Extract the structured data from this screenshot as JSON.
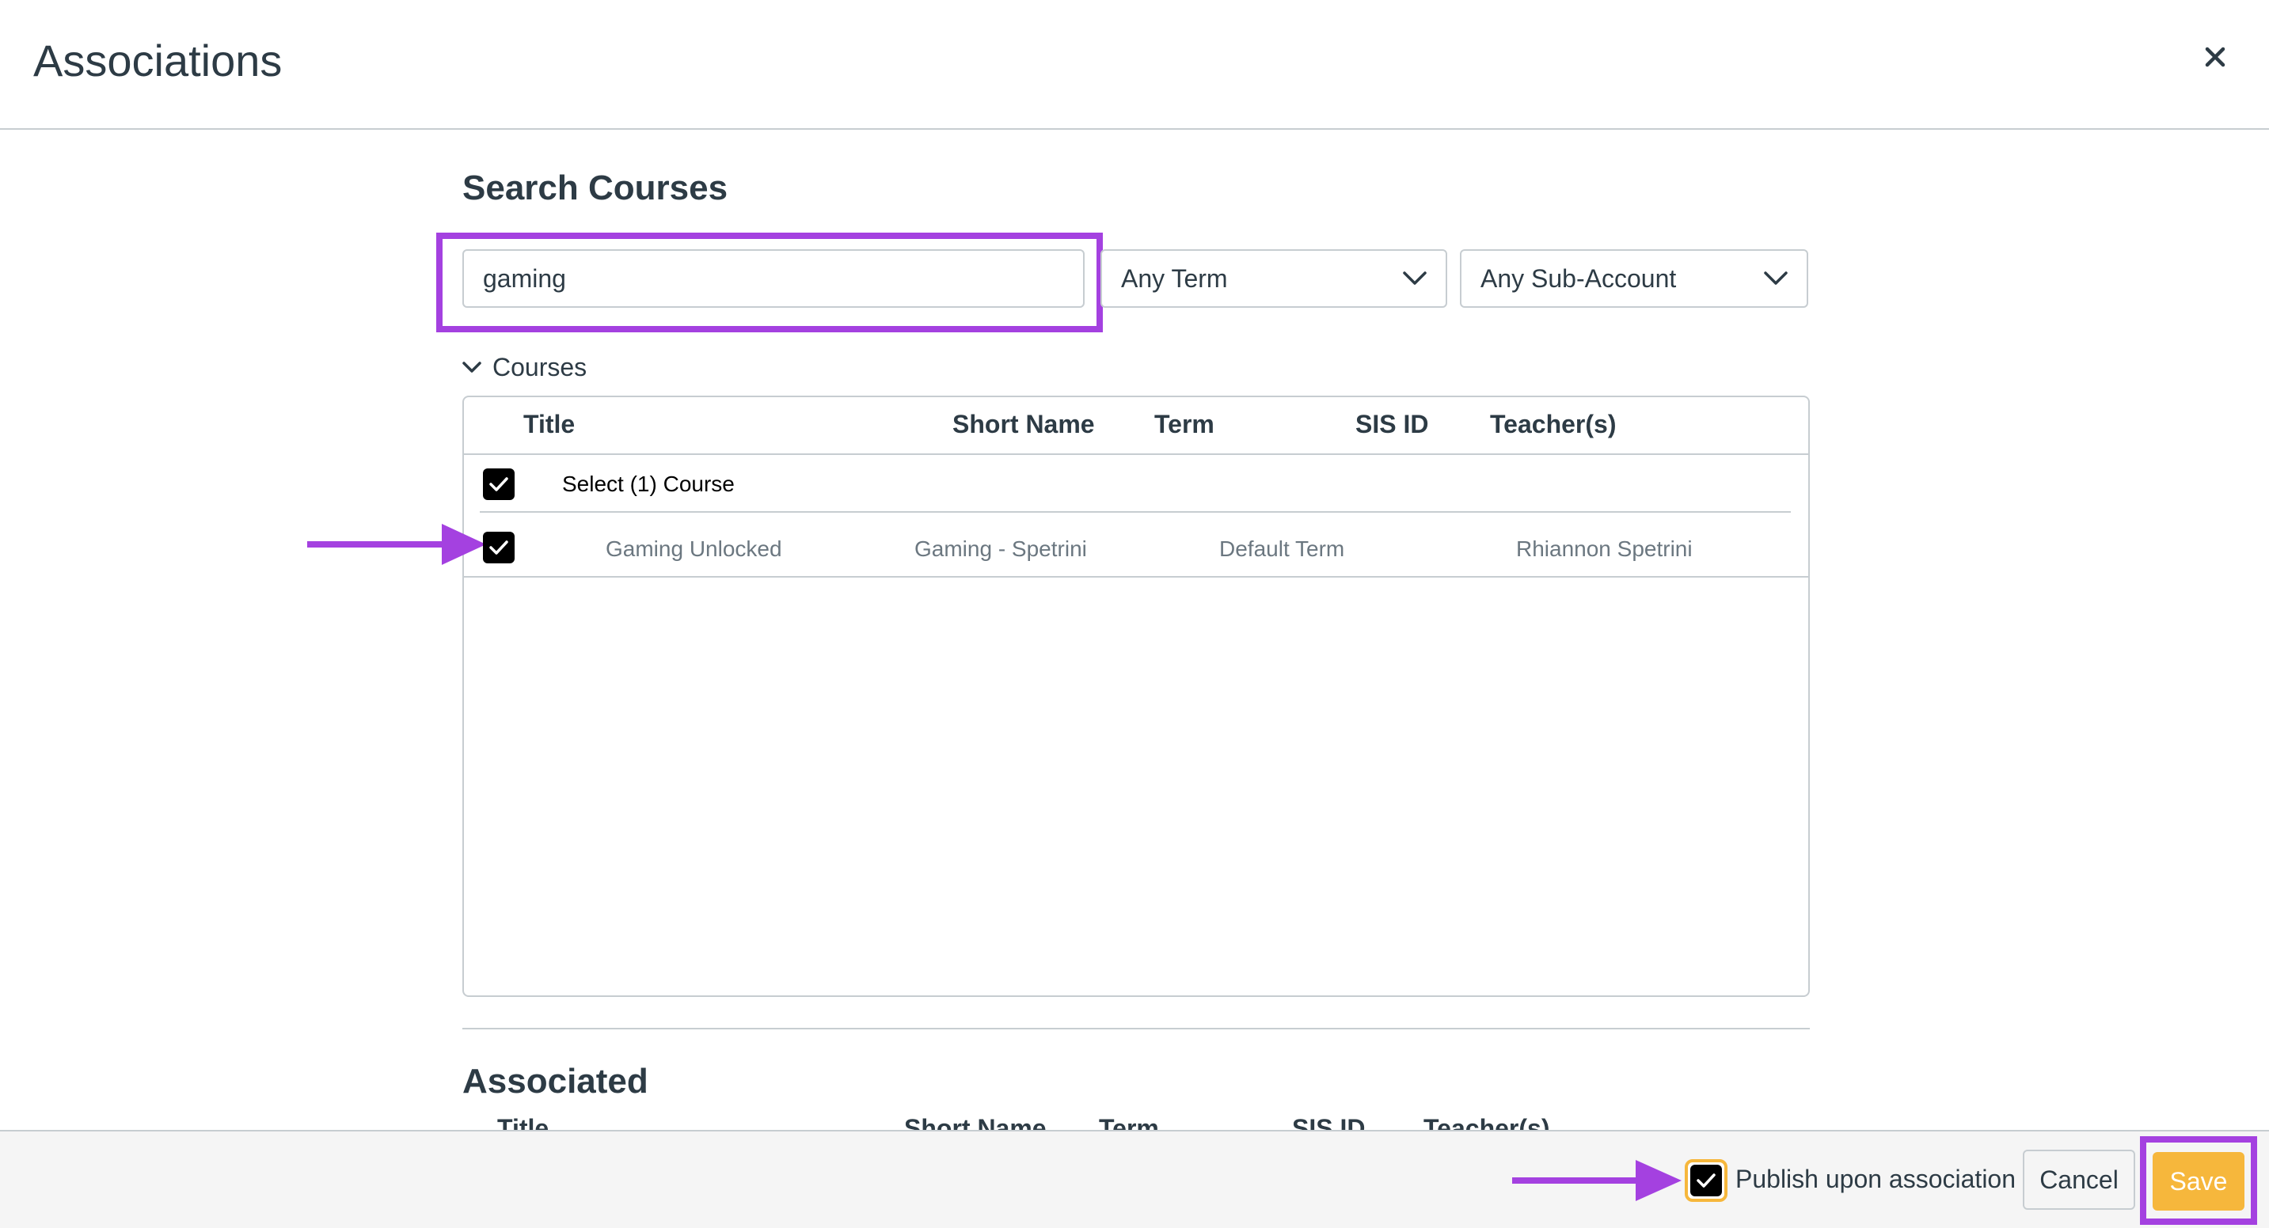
{
  "colors": {
    "annotation": "#a441e0",
    "save_button": "#f6b73c",
    "border": "#c7cdd1",
    "text": "#2d3b45",
    "muted_text": "#6b7780",
    "footer_bg": "#f5f5f5"
  },
  "modal": {
    "title": "Associations",
    "close_icon": "close-icon"
  },
  "search": {
    "heading": "Search Courses",
    "query": "gaming",
    "term_select": "Any Term",
    "subaccount_select": "Any Sub-Account"
  },
  "courses": {
    "toggle_label": "Courses",
    "columns": [
      "Title",
      "Short Name",
      "Term",
      "SIS ID",
      "Teacher(s)"
    ],
    "select_all_label": "Select (1) Course",
    "select_all_checked": true,
    "rows": [
      {
        "checked": true,
        "title": "Gaming Unlocked",
        "short_name": "Gaming - Spetrini",
        "term": "Default Term",
        "sis_id": "",
        "teachers": "Rhiannon Spetrini"
      }
    ]
  },
  "associated": {
    "heading": "Associated",
    "columns": [
      "Title",
      "Short Name",
      "Term",
      "SIS ID",
      "Teacher(s)"
    ]
  },
  "footer": {
    "publish_label": "Publish upon association",
    "publish_checked": true,
    "cancel_label": "Cancel",
    "save_label": "Save"
  }
}
